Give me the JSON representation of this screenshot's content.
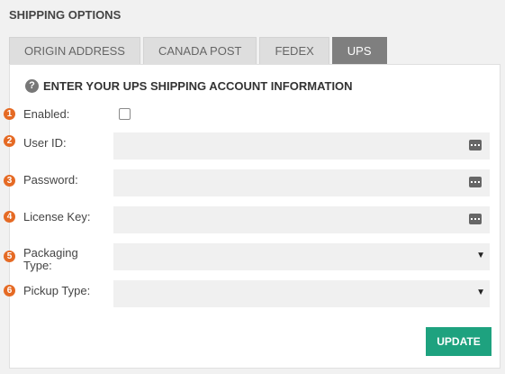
{
  "panel": {
    "title": "SHIPPING OPTIONS"
  },
  "tabs": [
    {
      "label": "ORIGIN ADDRESS",
      "active": false
    },
    {
      "label": "CANADA POST",
      "active": false
    },
    {
      "label": "FEDEX",
      "active": false
    },
    {
      "label": "UPS",
      "active": true
    }
  ],
  "section": {
    "help_icon": "question-icon",
    "header": "ENTER YOUR UPS SHIPPING ACCOUNT INFORMATION"
  },
  "fields": [
    {
      "num": "1",
      "label": "Enabled:",
      "type": "checkbox",
      "checked": false
    },
    {
      "num": "2",
      "label": "User ID:",
      "type": "text",
      "value": "",
      "icon": "dots-icon"
    },
    {
      "num": "3",
      "label": "Password:",
      "type": "password",
      "value": "",
      "icon": "dots-icon"
    },
    {
      "num": "4",
      "label": "License Key:",
      "type": "text",
      "value": "",
      "icon": "dots-icon"
    },
    {
      "num": "5",
      "label_line1": "Packaging",
      "label_line2": "Type:",
      "type": "select",
      "value": "",
      "icon": "caret-down-icon"
    },
    {
      "num": "6",
      "label": "Pickup Type:",
      "type": "select",
      "value": "",
      "icon": "caret-down-icon"
    }
  ],
  "actions": {
    "update_label": "UPDATE"
  },
  "colors": {
    "accent": "#1ea27f",
    "step_badge": "#e56a24",
    "active_tab": "#7f7f7f"
  }
}
